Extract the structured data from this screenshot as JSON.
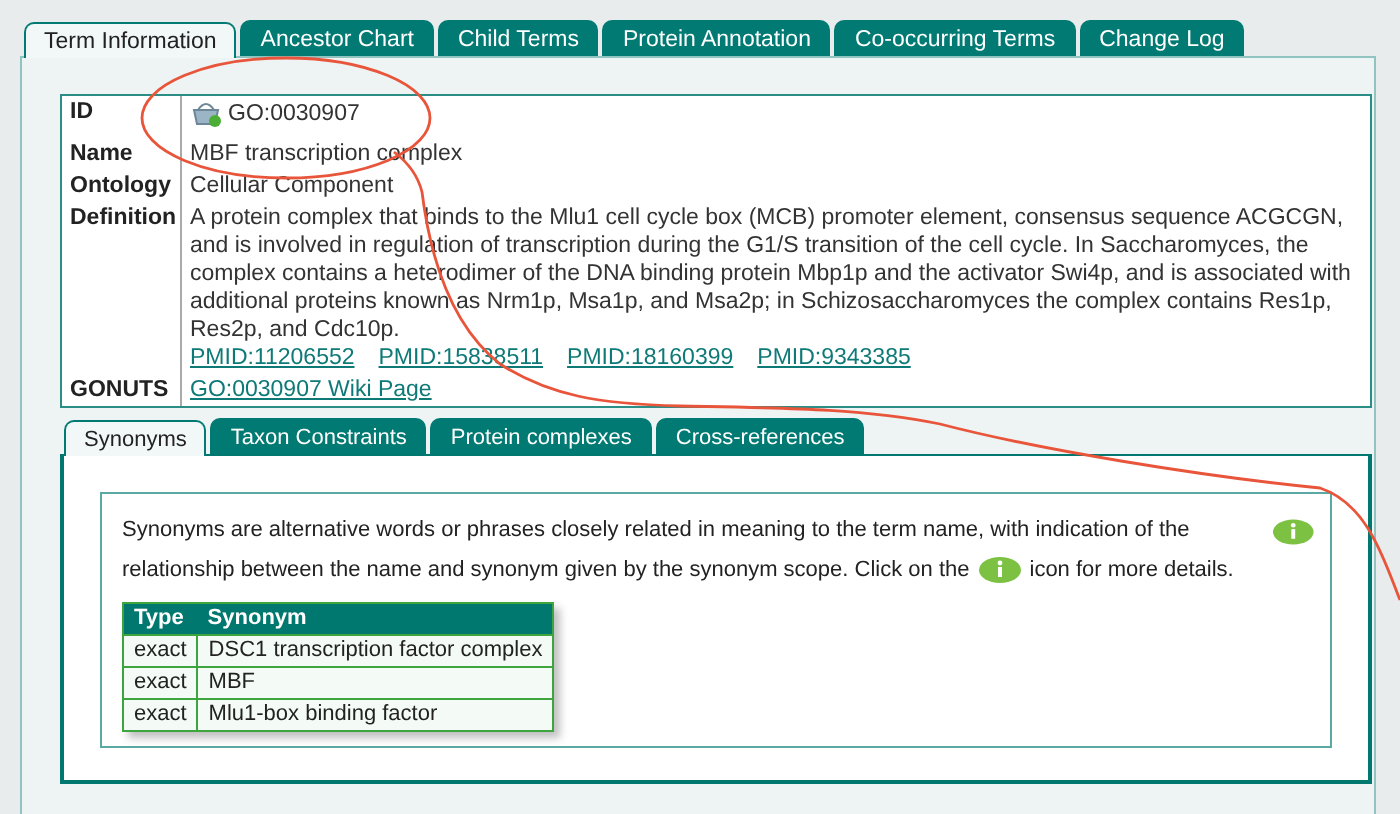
{
  "tabs": [
    {
      "label": "Term Information",
      "selected": true
    },
    {
      "label": "Ancestor Chart",
      "selected": false
    },
    {
      "label": "Child Terms",
      "selected": false
    },
    {
      "label": "Protein Annotation",
      "selected": false
    },
    {
      "label": "Co-occurring Terms",
      "selected": false
    },
    {
      "label": "Change Log",
      "selected": false
    }
  ],
  "term": [
    {
      "label": "ID",
      "kind": "id",
      "value": "GO:0030907"
    },
    {
      "label": "Name",
      "kind": "text",
      "value": "MBF transcription complex"
    },
    {
      "label": "Ontology",
      "kind": "text",
      "value": "Cellular Component"
    },
    {
      "label": "Definition",
      "kind": "definition",
      "value": "A protein complex that binds to the Mlu1 cell cycle box (MCB) promoter element, consensus sequence ACGCGN, and is involved in regulation of transcription during the G1/S transition of the cell cycle. In Saccharomyces, the complex contains a heterodimer of the DNA binding protein Mbp1p and the activator Swi4p, and is associated with additional proteins known as Nrm1p, Msa1p, and Msa2p; in Schizosaccharomyces the complex contains Res1p, Res2p, and Cdc10p.",
      "links": [
        "PMID:11206552",
        "PMID:15838511",
        "PMID:18160399",
        "PMID:9343385"
      ]
    },
    {
      "label": "GONUTS",
      "kind": "link",
      "value": "GO:0030907 Wiki Page"
    }
  ],
  "subtabs": [
    {
      "label": "Synonyms",
      "selected": true
    },
    {
      "label": "Taxon Constraints",
      "selected": false
    },
    {
      "label": "Protein complexes",
      "selected": false
    },
    {
      "label": "Cross-references",
      "selected": false
    }
  ],
  "synonyms": {
    "description": [
      "Synonyms are alternative words or phrases closely related in meaning to the term name, with indication of the",
      "relationship between the name and synonym given by the synonym scope. Click on the",
      "icon for more details."
    ],
    "columns": [
      "Type",
      "Synonym"
    ],
    "rows": [
      [
        "exact",
        "DSC1 transcription factor complex"
      ],
      [
        "exact",
        "MBF"
      ],
      [
        "exact",
        "Mlu1-box binding factor"
      ]
    ]
  }
}
